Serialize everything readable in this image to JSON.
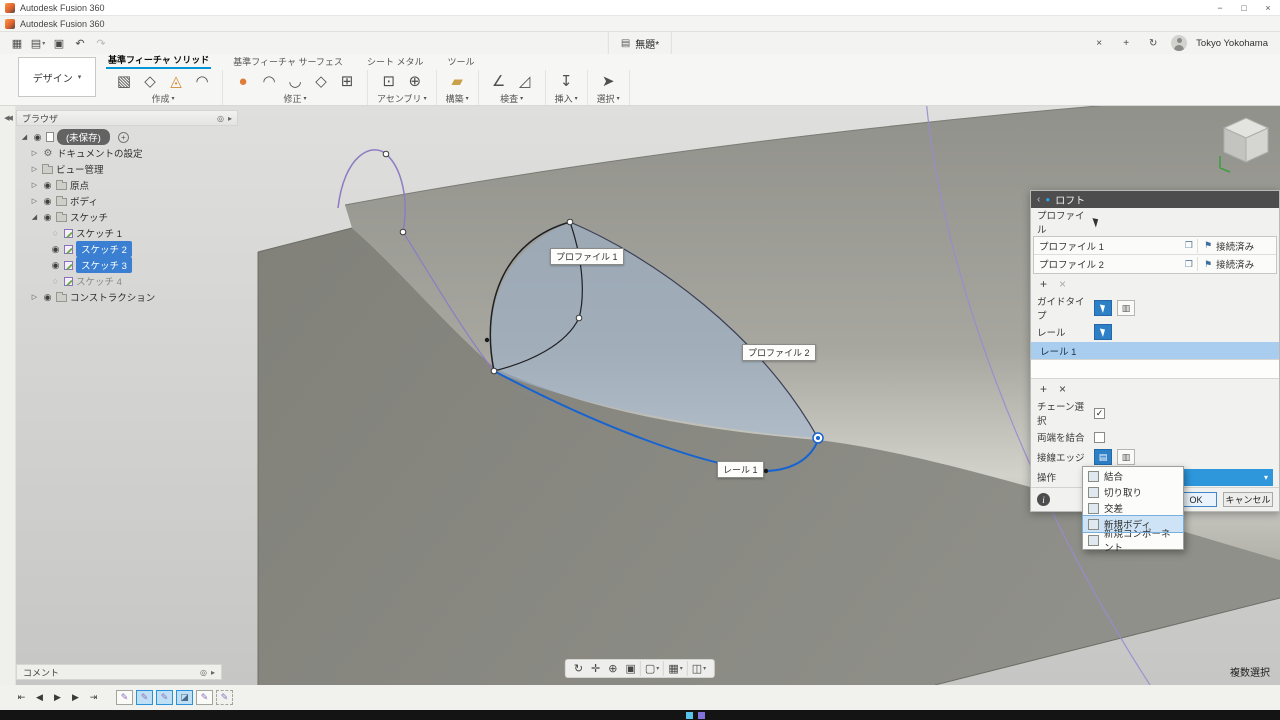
{
  "colors": {
    "accent_blue": "#0696d7",
    "selection_blue": "#3a7fd2",
    "row_highlight": "#a9cdee",
    "operation_bg": "#2e97dc",
    "dialog_header": "#4d4d4d"
  },
  "titlebar": {
    "title": "Autodesk Fusion 360"
  },
  "appbar": {
    "title": "Autodesk Fusion 360"
  },
  "quickbar": {
    "doc_tab": "無題*",
    "user_name": "Tokyo Yokohama"
  },
  "ribbon": {
    "workspace": "デザイン",
    "tabs": [
      "基準フィーチャ ソリッド",
      "基準フィーチャ サーフェス",
      "シート メタル",
      "ツール"
    ],
    "groups": [
      {
        "label": "作成",
        "icons": [
          "▧",
          "◇",
          "◬",
          "◠"
        ]
      },
      {
        "label": "修正",
        "icons": [
          "●",
          "◠",
          "◡",
          "◇",
          "⊞"
        ]
      },
      {
        "label": "アセンブリ",
        "icons": [
          "⊡",
          "⊕"
        ]
      },
      {
        "label": "構築",
        "icons": [
          "▰"
        ]
      },
      {
        "label": "検査",
        "icons": [
          "∠",
          "◿"
        ]
      },
      {
        "label": "挿入",
        "icons": [
          "↧"
        ]
      },
      {
        "label": "選択",
        "icons": [
          "➤"
        ]
      }
    ]
  },
  "browser": {
    "header": "ブラウザ",
    "root_label": "(未保存)",
    "items": [
      "ドキュメントの設定",
      "ビュー管理",
      "原点",
      "ボディ",
      "スケッチ",
      "コンストラクション"
    ],
    "sketches": [
      "スケッチ 1",
      "スケッチ 2",
      "スケッチ 3",
      "スケッチ 4"
    ]
  },
  "viewport": {
    "tag_profile1": "プロファイル 1",
    "tag_profile2": "プロファイル 2",
    "tag_rail1": "レール 1",
    "multi_select": "複数選択"
  },
  "loft_dialog": {
    "title": "ロフト",
    "profiles_label": "プロファイル",
    "profiles": [
      {
        "name": "プロファイル 1",
        "status": "接続済み"
      },
      {
        "name": "プロファイル 2",
        "status": "接続済み"
      }
    ],
    "guide_type_label": "ガイドタイプ",
    "rail_label": "レール",
    "rail_selected": "レール 1",
    "chain_label": "チェーン選択",
    "close_label": "両端を結合",
    "tangent_label": "接線エッジ",
    "operation_label": "操作",
    "operation_value": "結合",
    "operation_options": [
      "結合",
      "切り取り",
      "交差",
      "新規ボディ",
      "新規コンポーネント"
    ],
    "operation_highlighted": "新規ボディ",
    "ok": "OK",
    "cancel": "キャンセル",
    "info": "i"
  },
  "comment_panel": {
    "label": "コメント"
  },
  "icons": {
    "app_grid": "▦",
    "file_menu": "▤",
    "save": "▣",
    "undo": "↶",
    "redo": "↷",
    "doc": "▤",
    "close_tab": "×",
    "new_tab": "+",
    "sync": "↻",
    "win_min": "−",
    "win_max": "□",
    "win_close": "×",
    "collapse_left": "◀◀",
    "caret_down": "▾",
    "expander_closed": "▷",
    "expander_open": "◢",
    "eye_on": "◉",
    "eye_off": "○",
    "gear": "⚙",
    "panel_target": "◎",
    "panel_arrow": "▸",
    "plus": "+",
    "remove": "×",
    "check": "✓",
    "back": "‹",
    "dot": "●",
    "copy": "❐",
    "flag": "⚑",
    "orbit": "↻",
    "pan": "✛",
    "zoom": "⊕",
    "fit": "▣",
    "display": "▢",
    "grid": "▦",
    "layout": "◫",
    "step_start": "⇤",
    "step_back": "◀",
    "play": "▶",
    "step_fwd": "▶",
    "step_end": "⇥",
    "edge_a": "▤",
    "edge_b": "▥",
    "op_ico": "▦",
    "sketch_glyph": "✎",
    "loft_glyph": "◪"
  }
}
